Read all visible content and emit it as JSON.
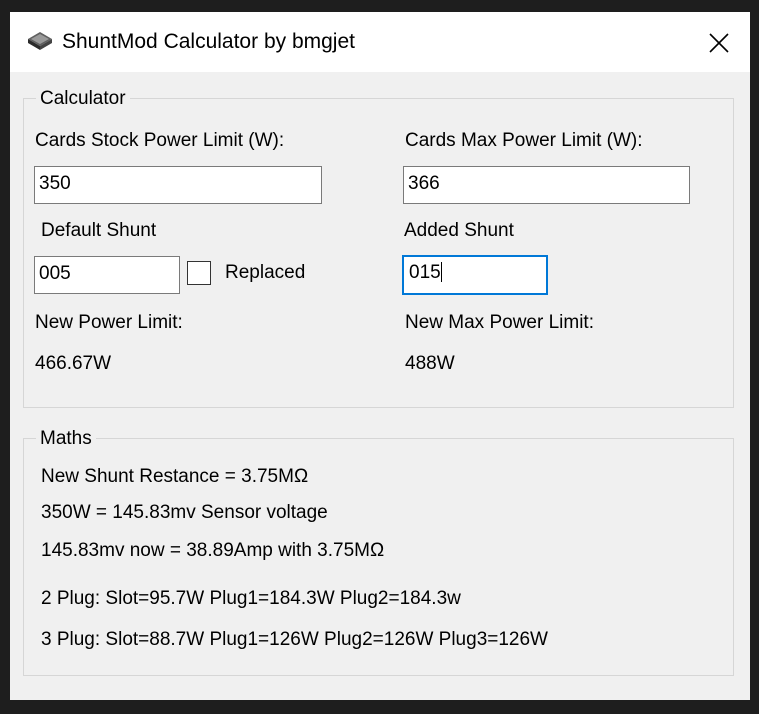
{
  "window": {
    "title": "ShuntMod Calculator by bmgjet"
  },
  "calculator": {
    "legend": "Calculator",
    "stock_label": "Cards Stock Power Limit (W):",
    "stock_value": "350",
    "max_label": "Cards Max Power Limit (W):",
    "max_value": "366",
    "default_shunt_label": "Default Shunt",
    "default_shunt_value": "005",
    "replaced_label": "Replaced",
    "replaced_checked": false,
    "added_shunt_label": "Added Shunt",
    "added_shunt_value": "015",
    "new_limit_label": "New Power Limit:",
    "new_limit_value": "466.67W",
    "new_max_label": "New Max Power Limit:",
    "new_max_value": "488W"
  },
  "maths": {
    "legend": "Maths",
    "lines": [
      "New Shunt Restance = 3.75MΩ",
      "350W = 145.83mv Sensor voltage",
      "145.83mv now = 38.89Amp with 3.75MΩ",
      "2 Plug: Slot=95.7W Plug1=184.3W Plug2=184.3w",
      "3 Plug: Slot=88.7W Plug1=126W Plug2=126W Plug3=126W"
    ]
  },
  "colors": {
    "focus_border": "#0078d7",
    "titlebar": "#ffffff",
    "client": "#f0f0f0",
    "frame": "#1e1e1e"
  }
}
